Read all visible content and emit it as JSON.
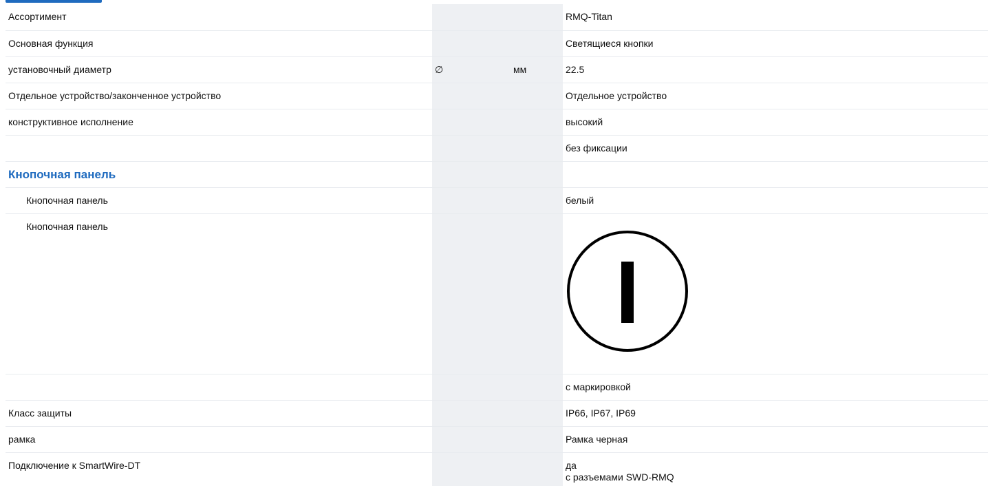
{
  "sections": {
    "main_rows": [
      {
        "label": "Ассортимент",
        "symbol": "",
        "unit": "",
        "value": "RMQ-Titan"
      },
      {
        "label": "Основная функция",
        "symbol": "",
        "unit": "",
        "value": "Светящиеся кнопки"
      },
      {
        "label": "установочный диаметр",
        "symbol": "∅",
        "unit": "мм",
        "value": "22.5"
      },
      {
        "label": "Отдельное устройство/законченное устройство",
        "symbol": "",
        "unit": "",
        "value": "Отдельное устройство"
      },
      {
        "label": "конструктивное исполнение",
        "symbol": "",
        "unit": "",
        "value": "высокий"
      },
      {
        "label": "",
        "symbol": "",
        "unit": "",
        "value": "без фиксации"
      }
    ],
    "button_panel": {
      "heading": "Кнопочная панель",
      "color_row": {
        "label": "Кнопочная панель",
        "value": "белый"
      },
      "symbol_row": {
        "label": "Кнопочная панель",
        "icon": "power-on-symbol-icon"
      },
      "marking_row": {
        "label": "",
        "value": "с маркировкой"
      }
    },
    "tail_rows": [
      {
        "label": "Класс защиты",
        "value": "IP66, IP67, IP69"
      },
      {
        "label": "рамка",
        "value": "Рамка черная"
      }
    ],
    "smartwire": {
      "label": "Подключение к SmartWire-DT",
      "value_line1": "да",
      "value_line2": "с разъемами SWD-RMQ"
    }
  },
  "colors": {
    "section_heading": "#1f6bbf",
    "shaded_column": "#eef0f3",
    "row_divider": "#e8ebef"
  }
}
